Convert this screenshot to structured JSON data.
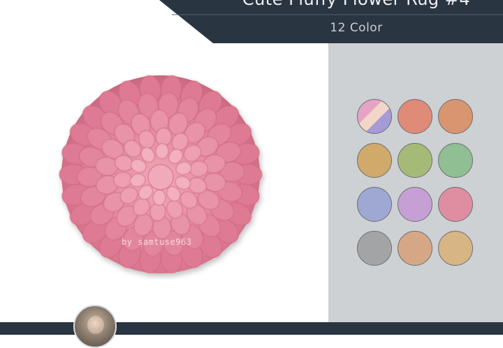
{
  "header": {
    "title": "Cute Fluffy Flower Rug #4",
    "subtitle": "12 Color"
  },
  "product": {
    "name": "fluffy flower rug",
    "watermark": "by samtuse963"
  },
  "swatches": [
    {
      "name": "swatch-multicolor",
      "colors": [
        "#e7a3c6",
        "#f2d6c8",
        "#a59bd6"
      ]
    },
    {
      "name": "swatch-coral",
      "color": "#df8b77"
    },
    {
      "name": "swatch-orange",
      "color": "#d9956f"
    },
    {
      "name": "swatch-mustard",
      "color": "#cfaa6b"
    },
    {
      "name": "swatch-green",
      "color": "#a6ba77"
    },
    {
      "name": "swatch-mint",
      "color": "#8fbf92"
    },
    {
      "name": "swatch-blue",
      "color": "#9ea8d2"
    },
    {
      "name": "swatch-purple",
      "color": "#c6a0d5"
    },
    {
      "name": "swatch-pink",
      "color": "#df8ea2"
    },
    {
      "name": "swatch-gray",
      "color": "#a3a4a5"
    },
    {
      "name": "swatch-beige",
      "color": "#d6a786"
    },
    {
      "name": "swatch-tan",
      "color": "#d8b585"
    }
  ],
  "colors": {
    "banner": "#2a3542",
    "panel": "#cdd1d4",
    "rug_base": "#e07f97",
    "rug_light": "#f5bfc9"
  }
}
